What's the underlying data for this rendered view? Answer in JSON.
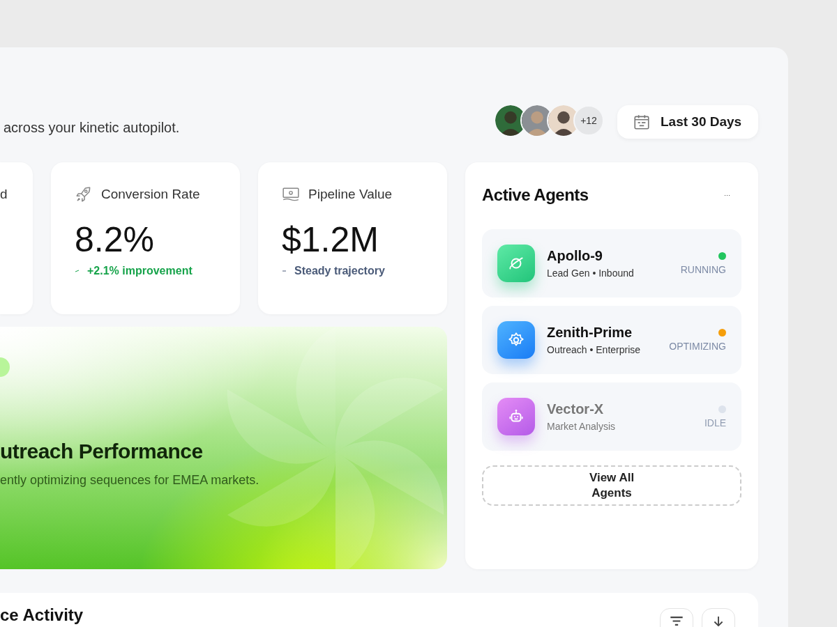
{
  "header": {
    "subtitle": "across your kinetic autopilot.",
    "team": {
      "more_count": "+12"
    },
    "date_range": "Last 30 Days"
  },
  "stats": [
    {
      "label": "d"
    },
    {
      "label": "Conversion Rate",
      "value": "8.2%",
      "delta": "+2.1% improvement",
      "positive": true
    },
    {
      "label": "Pipeline Value",
      "value": "$1.2M",
      "delta": "Steady trajectory",
      "positive": false
    }
  ],
  "hero": {
    "title": "utreach Performance",
    "subtitle": "ently optimizing sequences for EMEA markets."
  },
  "agents": {
    "title": "Active Agents",
    "more": "···",
    "items": [
      {
        "name": "Apollo-9",
        "tags": "Lead Gen • Inbound",
        "status": "RUNNING",
        "color": "#22c55e",
        "disabled": false
      },
      {
        "name": "Zenith-Prime",
        "tags": "Outreach • Enterprise",
        "status": "OPTIMIZING",
        "color": "#f59e0b",
        "disabled": false
      },
      {
        "name": "Vector-X",
        "tags": "Market Analysis",
        "status": "IDLE",
        "color": "#dde3ec",
        "disabled": true
      }
    ],
    "view_all": "View All Agents"
  },
  "activity": {
    "title": "ce Activity"
  }
}
